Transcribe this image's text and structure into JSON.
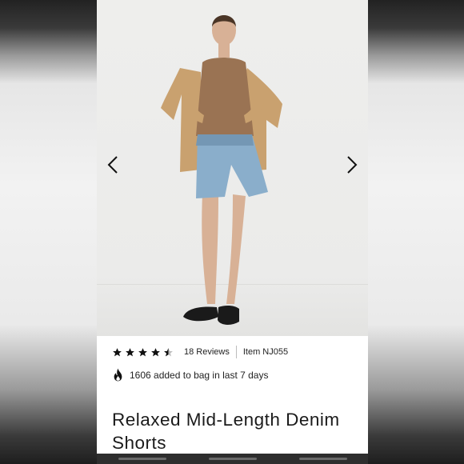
{
  "gallery": {
    "prev_icon": "chevron-left-icon",
    "next_icon": "chevron-right-icon",
    "colors": {
      "background": "#eeeeec",
      "shirt": "#c9a16f",
      "top": "#9a7353",
      "denim": "#8aaecb",
      "sandals": "#1a1a1a"
    }
  },
  "product": {
    "rating": 4.5,
    "rating_max": 5,
    "reviews": "18 Reviews",
    "item": "Item NJ055",
    "added_icon": "fire-icon",
    "added_text": "1606 added to bag in last 7 days",
    "title": "Relaxed Mid-Length Denim Shorts"
  }
}
